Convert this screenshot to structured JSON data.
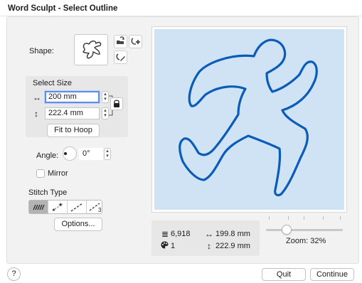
{
  "window": {
    "title": "Word Sculpt - Select Outline"
  },
  "shape": {
    "label": "Shape:"
  },
  "select_size": {
    "title": "Select Size",
    "width_icon": "↔",
    "width_value": "200 mm",
    "height_icon": "↕",
    "height_value": "222.4 mm",
    "fit_to_hoop_label": "Fit to Hoop"
  },
  "angle": {
    "label": "Angle:",
    "value": "0°"
  },
  "mirror": {
    "label": "Mirror",
    "checked": false
  },
  "stitch_type": {
    "label": "Stitch Type",
    "options_label": "Options...",
    "selected_index": 0
  },
  "info": {
    "stitches_icon": "≣",
    "stitches": "6,918",
    "width_icon": "↔",
    "width": "199.8 mm",
    "colors_icon": "palette-icon",
    "colors": "1",
    "height_icon": "↕",
    "height": "222.9 mm"
  },
  "zoom": {
    "label": "Zoom: 32%",
    "value_percent": 32
  },
  "footer": {
    "help_label": "?",
    "quit_label": "Quit",
    "continue_label": "Continue"
  },
  "colors": {
    "preview_bg": "#cfe3f5",
    "outline": "#0b5bb8",
    "focus": "#5b8def"
  }
}
